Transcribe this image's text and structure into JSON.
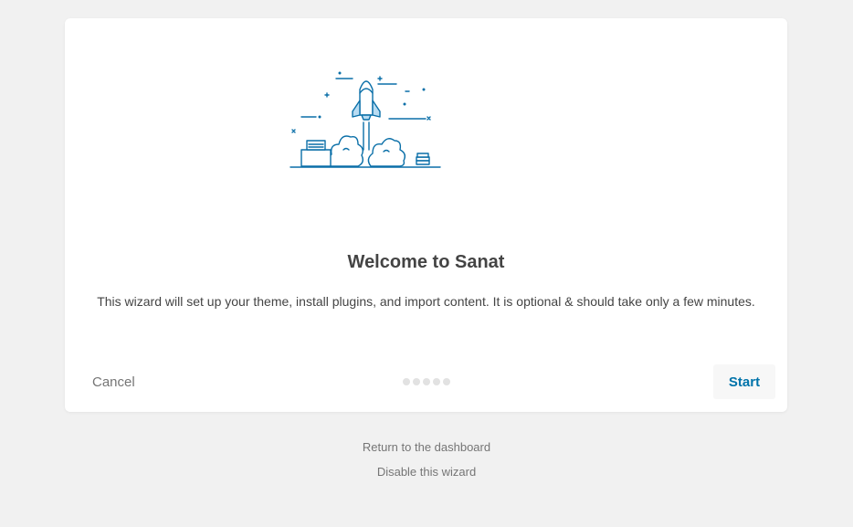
{
  "wizard": {
    "title": "Welcome to Sanat",
    "description": "This wizard will set up your theme, install plugins, and import content. It is optional & should take only a few minutes.",
    "cancel_label": "Cancel",
    "start_label": "Start",
    "steps_total": 5,
    "current_step": 1,
    "illustration_icon": "rocket-launch-illustration",
    "accent_color": "#0073aa"
  },
  "footer": {
    "dashboard_link": "Return to the dashboard",
    "disable_link": "Disable this wizard"
  }
}
